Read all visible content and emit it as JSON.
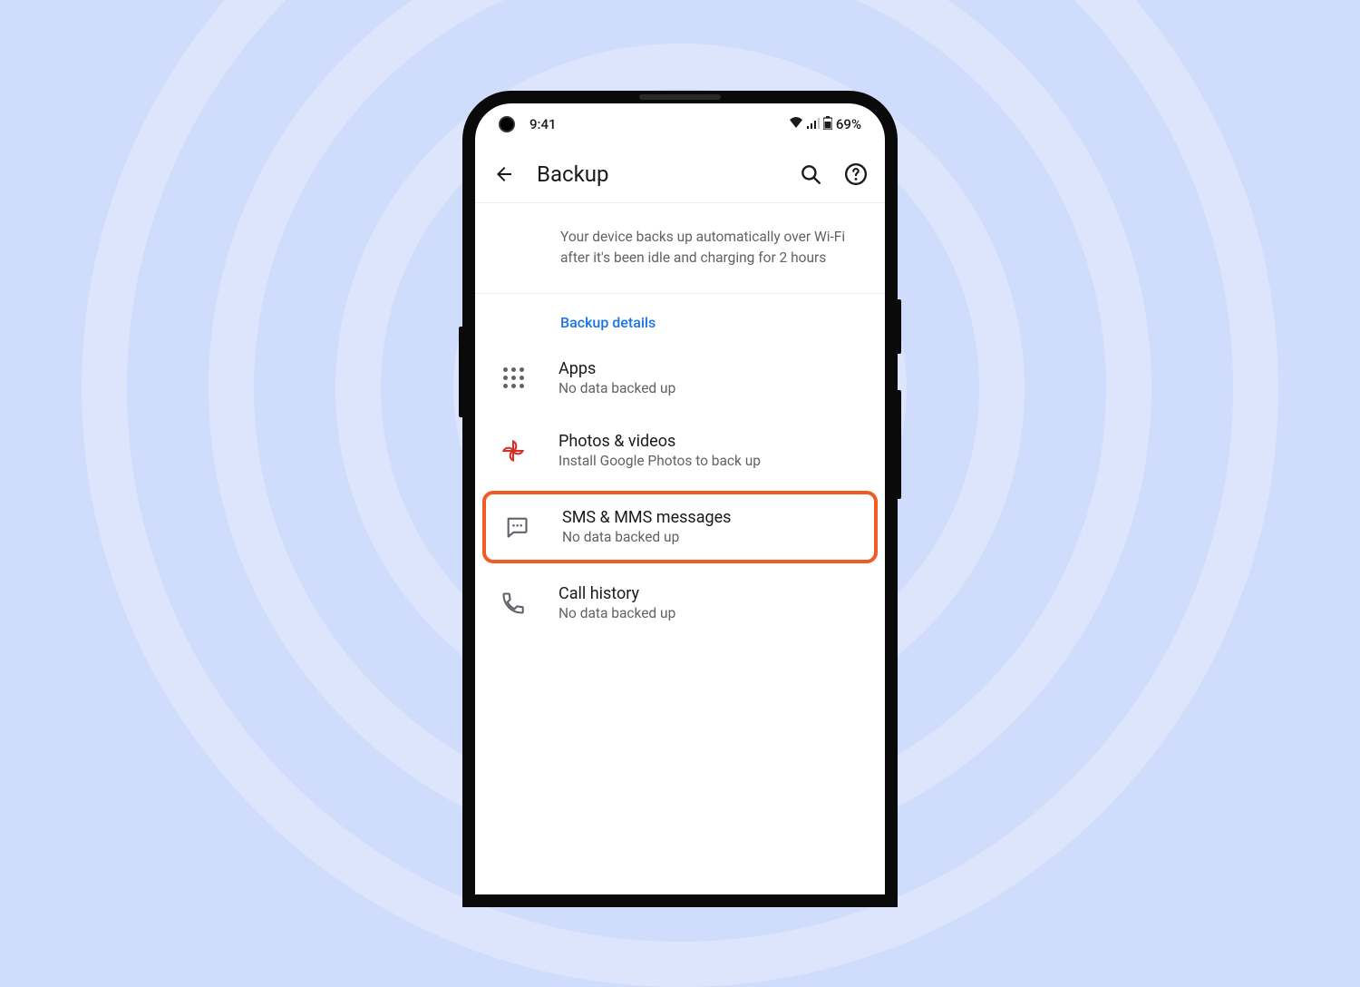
{
  "status_bar": {
    "time": "9:41",
    "battery": "69%"
  },
  "app_bar": {
    "title": "Backup"
  },
  "info_text": "Your device backs up automatically over Wi-Fi after it's been idle and charging for 2 hours",
  "section_header": "Backup details",
  "items": [
    {
      "title": "Apps",
      "subtitle": "No data backed up"
    },
    {
      "title": "Photos & videos",
      "subtitle": "Install Google Photos to back up"
    },
    {
      "title": "SMS & MMS messages",
      "subtitle": "No data backed up"
    },
    {
      "title": "Call history",
      "subtitle": "No data backed up"
    }
  ],
  "highlighted_index": 2
}
